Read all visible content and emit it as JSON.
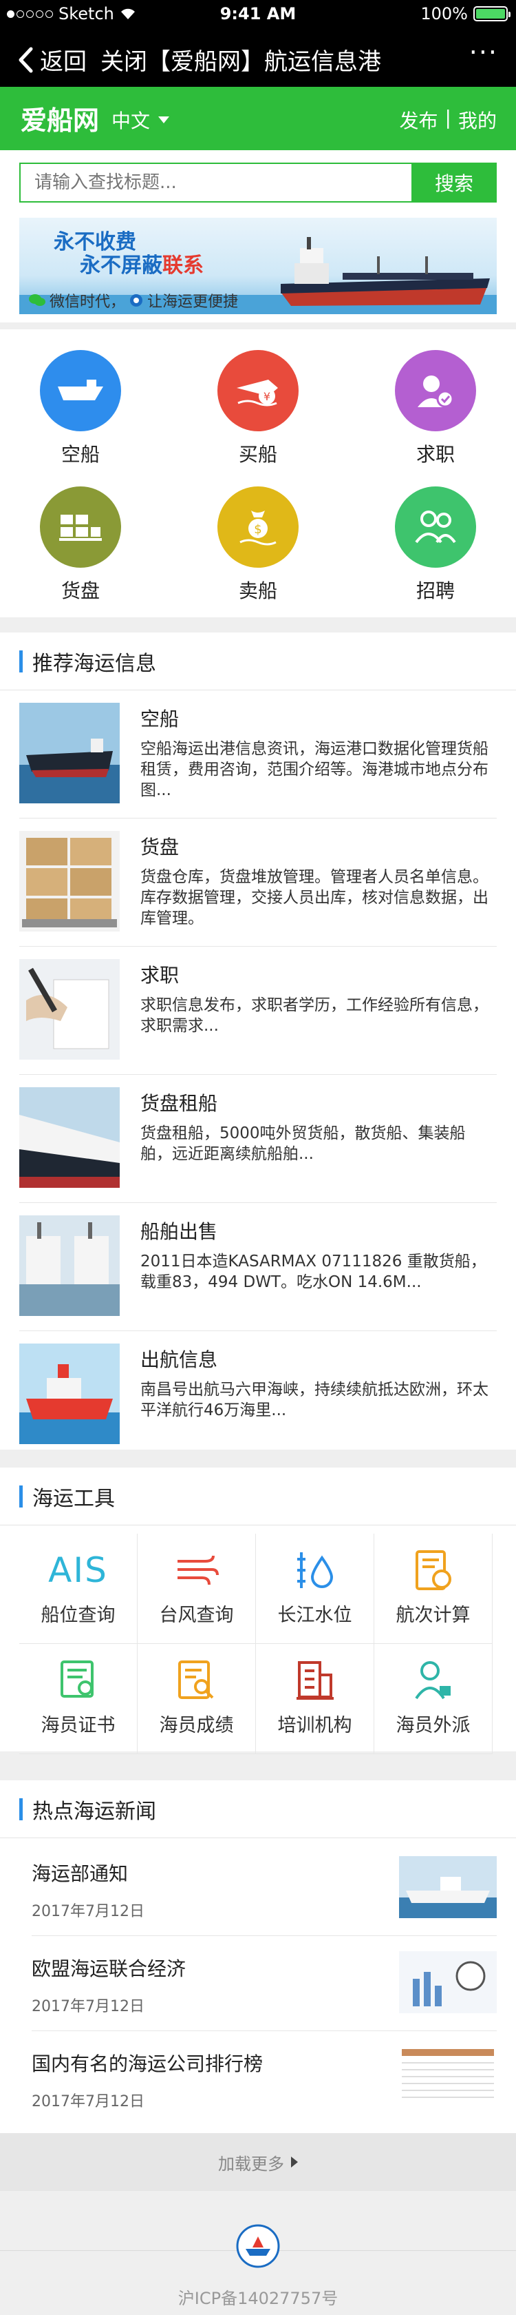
{
  "status_bar": {
    "carrier": "Sketch",
    "time": "9:41 AM",
    "battery": "100%",
    "battery_level": 1.0
  },
  "nav": {
    "back": "返回",
    "close": "关闭",
    "title": "【爱船网】航运信息港",
    "more": "···"
  },
  "header": {
    "logo": "爱船网",
    "lang": "中文",
    "publish": "发布",
    "divider": "|",
    "mine": "我的",
    "brand_color": "#2ebd3b"
  },
  "search": {
    "placeholder": "请输入查找标题...",
    "button": "搜索"
  },
  "banner": {
    "line1": "永不收费",
    "line2_a": "永不屏蔽",
    "line2_b": "联系",
    "line3_a": "微信时代，",
    "line3_b": "让海运更便捷"
  },
  "categories": [
    {
      "label": "空船",
      "icon": "empty-ship-icon",
      "color": "#2e8ded"
    },
    {
      "label": "买船",
      "icon": "buy-ship-icon",
      "color": "#e84b3c"
    },
    {
      "label": "求职",
      "icon": "job-seek-icon",
      "color": "#b45fd1"
    },
    {
      "label": "货盘",
      "icon": "cargo-icon",
      "color": "#8a9a36"
    },
    {
      "label": "卖船",
      "icon": "sell-ship-icon",
      "color": "#e0b818"
    },
    {
      "label": "招聘",
      "icon": "recruit-icon",
      "color": "#3ec46d"
    }
  ],
  "recommend": {
    "title": "推荐海运信息",
    "items": [
      {
        "title": "空船",
        "desc": "空船海运出港信息资讯，海运港口数据化管理货船租赁，费用咨询，范围介绍等。海港城市地点分布图..."
      },
      {
        "title": "货盘",
        "desc": "货盘仓库，货盘堆放管理。管理者人员名单信息。库存数据管理，交接人员出库，核对信息数据，出库管理。"
      },
      {
        "title": "求职",
        "desc": "求职信息发布，求职者学历，工作经验所有信息，求职需求..."
      },
      {
        "title": "货盘租船",
        "desc": "货盘租船，5000吨外贸货船，散货船、集装船舶，远近距离续航船舶..."
      },
      {
        "title": "船舶出售",
        "desc": "2011日本造KASARMAX 07111826 重散货船，载重83，494 DWT。吃水ON 14.6M..."
      },
      {
        "title": "出航信息",
        "desc": "南昌号出航马六甲海峡，持续续航抵达欧洲，环太平洋航行46万海里..."
      }
    ]
  },
  "tools": {
    "title": "海运工具",
    "items": [
      {
        "label": "船位查询",
        "icon": "ais-icon",
        "glyph": "AIS",
        "color": "#2eb5d8"
      },
      {
        "label": "台风查询",
        "icon": "typhoon-icon",
        "color": "#e84b3c"
      },
      {
        "label": "长江水位",
        "icon": "water-level-icon",
        "color": "#2b8fe8"
      },
      {
        "label": "航次计算",
        "icon": "voyage-calc-icon",
        "color": "#f0a21e"
      },
      {
        "label": "海员证书",
        "icon": "certificate-icon",
        "color": "#3ec46d"
      },
      {
        "label": "海员成绩",
        "icon": "score-icon",
        "color": "#f0a21e"
      },
      {
        "label": "培训机构",
        "icon": "training-icon",
        "color": "#c0392b"
      },
      {
        "label": "海员外派",
        "icon": "dispatch-icon",
        "color": "#2eb5a8"
      }
    ]
  },
  "news": {
    "title": "热点海运新闻",
    "items": [
      {
        "title": "海运部通知",
        "date": "2017年7月12日"
      },
      {
        "title": "欧盟海运联合经济",
        "date": "2017年7月12日"
      },
      {
        "title": "国内有名的海运公司排行榜",
        "date": "2017年7月12日"
      }
    ]
  },
  "load_more": "加载更多",
  "footer": {
    "icp": "沪ICP备14027757号"
  }
}
